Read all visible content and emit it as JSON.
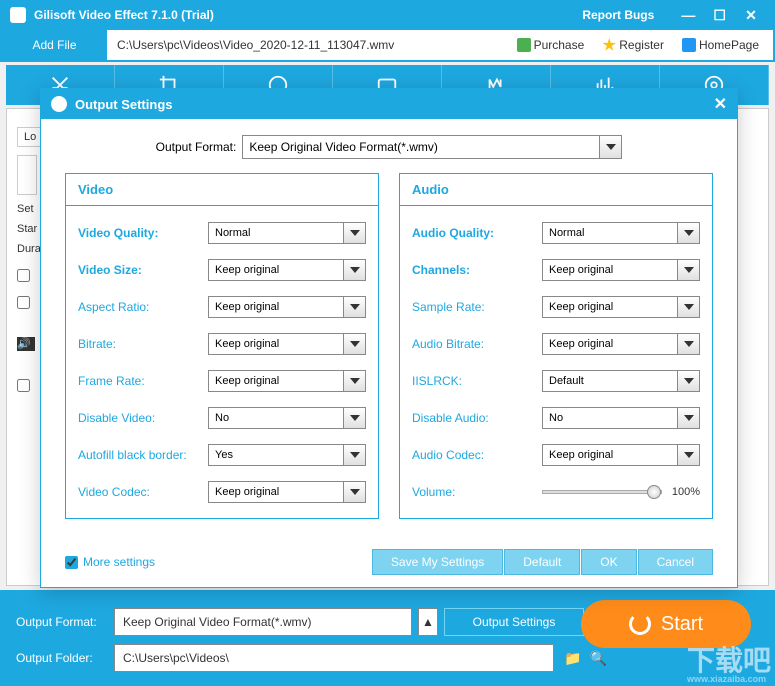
{
  "titlebar": {
    "title": "Gilisoft Video Effect 7.1.0 (Trial)",
    "report_bugs": "Report Bugs"
  },
  "toprow": {
    "add_file": "Add File",
    "path": "C:\\Users\\pc\\Videos\\Video_2020-12-11_113047.wmv",
    "purchase": "Purchase",
    "register": "Register",
    "homepage": "HomePage"
  },
  "mainbg": {
    "lo": "Lo",
    "set": "Set",
    "star": "Star",
    "dura": "Dura"
  },
  "modal": {
    "title": "Output Settings",
    "output_format_label": "Output Format:",
    "output_format_value": "Keep Original Video Format(*.wmv)",
    "video_head": "Video",
    "audio_head": "Audio",
    "video": {
      "quality_lbl": "Video Quality:",
      "quality_val": "Normal",
      "size_lbl": "Video Size:",
      "size_val": "Keep original",
      "aspect_lbl": "Aspect Ratio:",
      "aspect_val": "Keep original",
      "bitrate_lbl": "Bitrate:",
      "bitrate_val": "Keep original",
      "fps_lbl": "Frame Rate:",
      "fps_val": "Keep original",
      "disable_lbl": "Disable Video:",
      "disable_val": "No",
      "autofill_lbl": "Autofill black border:",
      "autofill_val": "Yes",
      "codec_lbl": "Video Codec:",
      "codec_val": "Keep original"
    },
    "audio": {
      "quality_lbl": "Audio Quality:",
      "quality_val": "Normal",
      "channels_lbl": "Channels:",
      "channels_val": "Keep original",
      "sample_lbl": "Sample Rate:",
      "sample_val": "Keep original",
      "bitrate_lbl": "Audio Bitrate:",
      "bitrate_val": "Keep original",
      "iislrck_lbl": "IISLRCK:",
      "iislrck_val": "Default",
      "disable_lbl": "Disable Audio:",
      "disable_val": "No",
      "codec_lbl": "Audio Codec:",
      "codec_val": "Keep original",
      "volume_lbl": "Volume:",
      "volume_val": "100%"
    },
    "more_settings": "More settings",
    "btn_save": "Save My Settings",
    "btn_default": "Default",
    "btn_ok": "OK",
    "btn_cancel": "Cancel"
  },
  "bottom": {
    "output_format_label": "Output Format:",
    "output_format_value": "Keep Original Video Format(*.wmv)",
    "output_settings_btn": "Output Settings",
    "start": "Start",
    "output_folder_label": "Output Folder:",
    "output_folder_value": "C:\\Users\\pc\\Videos\\"
  },
  "watermark": {
    "main": "下载吧",
    "sub": "www.xiazaiba.com"
  }
}
